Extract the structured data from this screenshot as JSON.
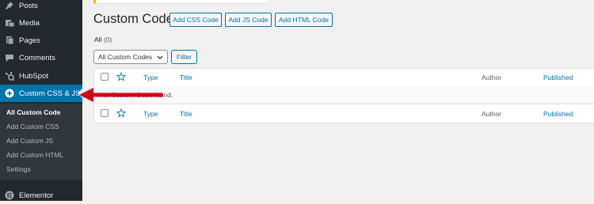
{
  "sidebar": {
    "menu": [
      {
        "label": "Posts",
        "icon": "pin-icon"
      },
      {
        "label": "Media",
        "icon": "media-icon"
      },
      {
        "label": "Pages",
        "icon": "pages-icon"
      },
      {
        "label": "Comments",
        "icon": "comments-icon"
      },
      {
        "label": "HubSpot",
        "icon": "hubspot-icon"
      },
      {
        "label": "Custom CSS & JS",
        "icon": "plus-circle-icon",
        "active": true
      }
    ],
    "submenu": [
      {
        "label": "All Custom Code",
        "current": true
      },
      {
        "label": "Add Custom CSS"
      },
      {
        "label": "Add Custom JS"
      },
      {
        "label": "Add Custom HTML"
      },
      {
        "label": "Settings"
      }
    ],
    "bottom": {
      "label": "Elementor",
      "icon": "elementor-icon"
    }
  },
  "header": {
    "title": "Custom Code",
    "buttons": [
      "Add CSS Code",
      "Add JS Code",
      "Add HTML Code"
    ]
  },
  "views": {
    "all_label": "All",
    "all_count": "(0)"
  },
  "filter": {
    "select_value": "All Custom Codes",
    "button": "Filter"
  },
  "table": {
    "columns": [
      "Type",
      "Title",
      "Author",
      "Published"
    ],
    "empty_message": "No Custom Code found."
  },
  "colors": {
    "sidebar_bg": "#23282d",
    "submenu_bg": "#32373c",
    "active_bg": "#0073aa",
    "link": "#0073aa",
    "annotation": "#d0021b"
  }
}
